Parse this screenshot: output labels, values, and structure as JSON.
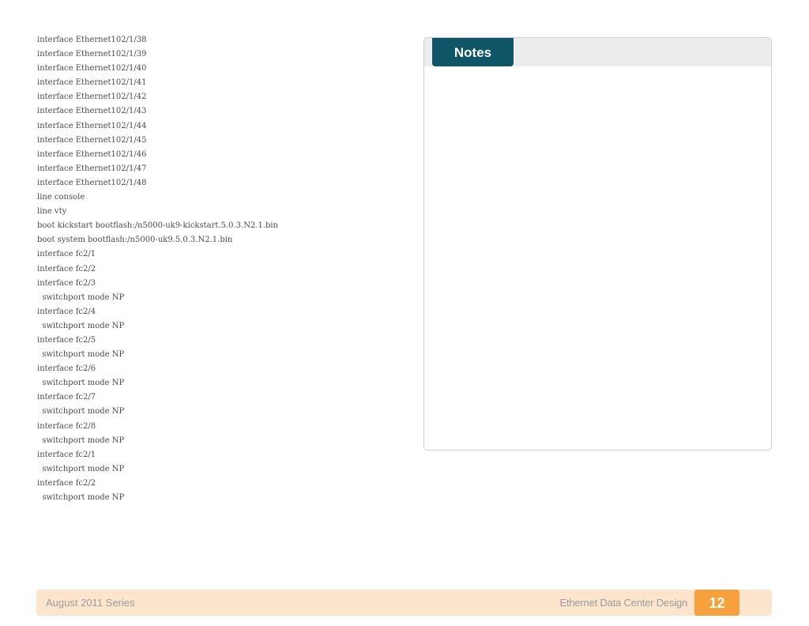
{
  "config_lines": [
    "interface Ethernet102/1/38",
    "interface Ethernet102/1/39",
    "interface Ethernet102/1/40",
    "interface Ethernet102/1/41",
    "interface Ethernet102/1/42",
    "interface Ethernet102/1/43",
    "interface Ethernet102/1/44",
    "interface Ethernet102/1/45",
    "interface Ethernet102/1/46",
    "interface Ethernet102/1/47",
    "interface Ethernet102/1/48",
    "line console",
    "line vty",
    "boot kickstart bootflash:/n5000-uk9-kickstart.5.0.3.N2.1.bin",
    "boot system bootflash:/n5000-uk9.5.0.3.N2.1.bin",
    "interface fc2/1",
    "interface fc2/2",
    "interface fc2/3",
    "  switchport mode NP",
    "interface fc2/4",
    "  switchport mode NP",
    "interface fc2/5",
    "  switchport mode NP",
    "interface fc2/6",
    "  switchport mode NP",
    "interface fc2/7",
    "  switchport mode NP",
    "interface fc2/8",
    "  switchport mode NP",
    "interface fc2/1",
    "  switchport mode NP",
    "interface fc2/2",
    "  switchport mode NP"
  ],
  "notes": {
    "title": "Notes"
  },
  "footer": {
    "series": "August 2011 Series",
    "document_title": "Ethernet Data Center Design",
    "page_number": "12"
  },
  "colors": {
    "notes_tab": "#0e5567",
    "footer_bar": "#fde5cd",
    "page_box": "#f7a13d",
    "text": "#4a4a4a"
  }
}
